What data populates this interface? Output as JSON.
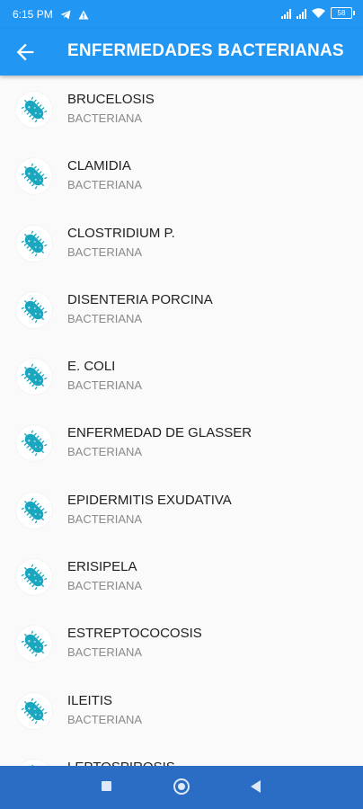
{
  "status": {
    "time": "6:15 PM",
    "battery": "58"
  },
  "app_bar": {
    "title": "ENFERMEDADES BACTERIANAS",
    "icon": "arrow-back-icon"
  },
  "colors": {
    "primary": "#2196f3",
    "nav": "#2b6cc4",
    "bacteria": "#19a6bf"
  },
  "items": [
    {
      "name": "BRUCELOSIS",
      "type": "BACTERIANA"
    },
    {
      "name": "CLAMIDIA",
      "type": "BACTERIANA"
    },
    {
      "name": "CLOSTRIDIUM P.",
      "type": "BACTERIANA"
    },
    {
      "name": "DISENTERIA PORCINA",
      "type": "BACTERIANA"
    },
    {
      "name": "E. COLI",
      "type": "BACTERIANA"
    },
    {
      "name": "ENFERMEDAD DE GLASSER",
      "type": "BACTERIANA"
    },
    {
      "name": "EPIDERMITIS EXUDATIVA",
      "type": "BACTERIANA"
    },
    {
      "name": "ERISIPELA",
      "type": "BACTERIANA"
    },
    {
      "name": "ESTREPTOCOCOSIS",
      "type": "BACTERIANA"
    },
    {
      "name": "ILEITIS",
      "type": "BACTERIANA"
    },
    {
      "name": "LEPTOSPIROSIS",
      "type": ""
    }
  ]
}
